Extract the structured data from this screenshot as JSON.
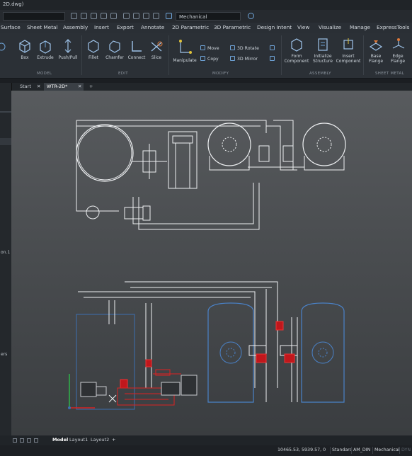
{
  "window": {
    "title": "2D.dwg)"
  },
  "qat": {
    "workspace": "Mechanical"
  },
  "menu": [
    "Surface",
    "Sheet Metal",
    "Assembly",
    "Insert",
    "Export",
    "Annotate",
    "2D Parametric",
    "3D Parametric",
    "Design Intent",
    "View",
    "Visualize",
    "Manage",
    "ExpressTools"
  ],
  "ribbon": {
    "model_tools": [
      "Box",
      "Extrude",
      "Push/Pull"
    ],
    "edit_tools": [
      "Fillet",
      "Chamfer",
      "Connect",
      "Slice"
    ],
    "manipulate": "Manipulate",
    "modify_small": [
      "Move",
      "Copy",
      "3D Rotate",
      "3D Mirror"
    ],
    "assembly_tools": [
      "Form Component",
      "Initialize Structure",
      "Insert Component"
    ],
    "sheetmetal_tools": [
      "Base Flange",
      "Edge Flange"
    ],
    "panels": [
      "MODEL",
      "EDIT",
      "MODIFY",
      "ASSEMBLY",
      "SHEET METAL"
    ]
  },
  "tabs": {
    "start": "Start",
    "doc": "WTR-2D*",
    "add": "+"
  },
  "leftpanel": [
    "on.1",
    "ers"
  ],
  "layout_tabs": [
    "Model",
    "Layout1",
    "Layout2"
  ],
  "layout_add": "+",
  "status": {
    "coords": "10465.53, 5939.57, 0",
    "fields": [
      "Standard",
      "AM_DIN",
      "Mechanical",
      "DYN"
    ]
  }
}
